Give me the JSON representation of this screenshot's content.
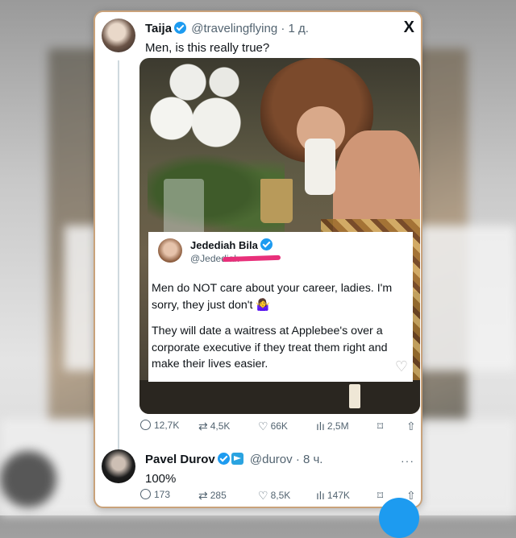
{
  "main_tweet": {
    "author_name": "Taija",
    "author_handle": "@travelingflying",
    "time": "· 1 д.",
    "text": "Men, is this really true?",
    "logo": "X",
    "embedded": {
      "name": "Jedediah Bila",
      "handle": "@Jedediah",
      "paragraph1": "Men do NOT care about your career, ladies. I'm sorry, they just don't 🤷‍♀️",
      "paragraph2": "They will date a waitress at Applebee's over a corporate executive if they treat them right and make their lives easier."
    },
    "stats": {
      "replies": "12,7K",
      "reposts": "4,5K",
      "likes": "66K",
      "views": "2,5M"
    }
  },
  "reply_tweet": {
    "author_name": "Pavel Durov",
    "author_handle": "@durov",
    "time": "· 8 ч.",
    "text": "100%",
    "stats": {
      "replies": "173",
      "reposts": "285",
      "likes": "8,5K",
      "views": "147K"
    }
  },
  "icons": {
    "reply": "reply-icon",
    "repost": "repost-icon",
    "like": "heart-icon",
    "views": "views-icon",
    "bookmark": "bookmark-icon",
    "share": "share-icon"
  },
  "colors": {
    "accent": "#1d9bf0",
    "frame": "#c9a27a",
    "scribble": "#e8307a"
  }
}
